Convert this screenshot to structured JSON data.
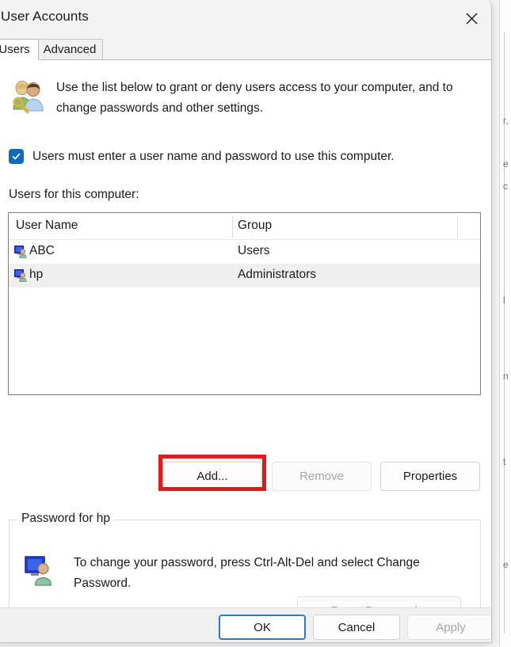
{
  "window": {
    "title": "User Accounts",
    "close_icon": "close-icon"
  },
  "tabs": [
    {
      "label": "Users",
      "selected": true
    },
    {
      "label": "Advanced",
      "selected": false
    }
  ],
  "intro": {
    "icon": "users-with-key-icon",
    "text": "Use the list below to grant or deny users access to your computer, and to change passwords and other settings."
  },
  "require_login_checkbox": {
    "label": "Users must enter a user name and password to use this computer.",
    "checked": true,
    "check_glyph": "checkmark-icon",
    "accent_color": "#0f6cbd"
  },
  "users_list": {
    "label": "Users for this computer:",
    "columns": [
      "User Name",
      "Group"
    ],
    "rows": [
      {
        "name": "ABC",
        "group": "Users",
        "selected": false,
        "icon": "user-account-icon"
      },
      {
        "name": "hp",
        "group": "Administrators",
        "selected": true,
        "icon": "user-account-icon"
      }
    ]
  },
  "actions": {
    "add_label": "Add...",
    "remove_label": "Remove",
    "properties_label": "Properties",
    "remove_disabled": true,
    "highlight_color": "#e01b1b",
    "highlighted_button": "Add..."
  },
  "password_group": {
    "legend": "Password for hp",
    "icon": "user-account-icon",
    "text": "To change your password, press Ctrl-Alt-Del and select Change Password.",
    "reset_label": "Reset Password...",
    "reset_disabled": true
  },
  "footer": {
    "ok_label": "OK",
    "cancel_label": "Cancel",
    "apply_label": "Apply",
    "apply_disabled": true,
    "default_button": "OK"
  }
}
